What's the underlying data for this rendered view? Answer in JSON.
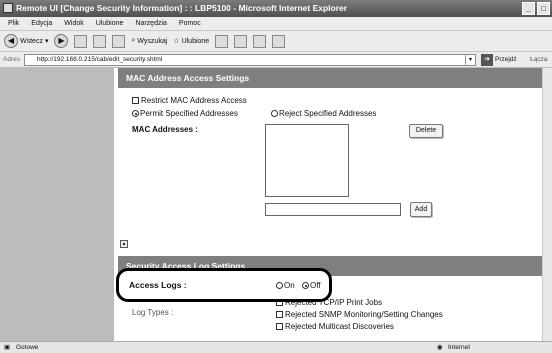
{
  "window": {
    "title": "Remote UI [Change Security Information] : : LBP5100 - Microsoft Internet Explorer"
  },
  "menu": [
    "Plik",
    "Edycja",
    "Widok",
    "Ulubione",
    "Narzędzia",
    "Pomoc"
  ],
  "toolbar": {
    "back_label": "Wstecz",
    "search_label": "Wyszukaj",
    "favorites_label": "Ulubione"
  },
  "address": {
    "label": "Adres",
    "url": "http://192.168.0.215/cab/edit_security.shtml",
    "go_label": "Przejdź",
    "links_label": "Łącza"
  },
  "mac_section": {
    "title": "MAC Address Access Settings",
    "restrict_label": "Restrict MAC Address Access",
    "permit_label": "Permit Specified Addresses",
    "reject_label": "Reject Specified Addresses",
    "addresses_label": "MAC Addresses :",
    "delete_label": "Delete",
    "add_label": "Add"
  },
  "log_section": {
    "title": "Security Access Log Settings",
    "access_logs_label": "Access Logs :",
    "on_label": "On",
    "off_label": "Off",
    "partial_label": "Log Types :",
    "tcp_label": "Rejected TCP/IP Print Jobs",
    "snmp_label": "Rejected SNMP Monitoring/Setting Changes",
    "multicast_label": "Rejected Multicast Discoveries"
  },
  "status": {
    "left": "Gotowe",
    "right": "Internet"
  }
}
